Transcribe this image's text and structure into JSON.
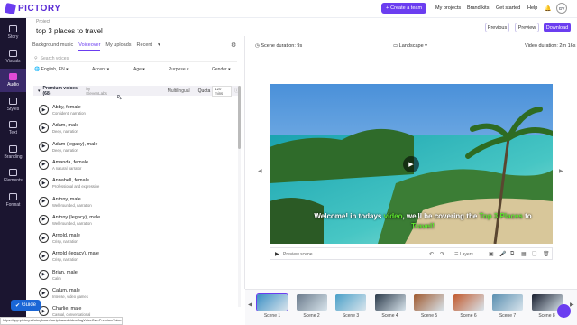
{
  "app": {
    "logo_text": "PICTORY"
  },
  "topbar": {
    "create_team": "Create a team",
    "my_projects": "My projects",
    "brand_kits": "Brand kits",
    "get_started": "Get started",
    "help": "Help",
    "avatar_initials": "GV"
  },
  "sidebar": {
    "items": [
      {
        "label": "Story",
        "icon": "story-icon"
      },
      {
        "label": "Visuals",
        "icon": "visuals-icon"
      },
      {
        "label": "Audio",
        "icon": "audio-icon",
        "active": true
      },
      {
        "label": "Styles",
        "icon": "styles-icon"
      },
      {
        "label": "Text",
        "icon": "text-icon"
      },
      {
        "label": "Branding",
        "icon": "branding-icon"
      },
      {
        "label": "Elements",
        "icon": "elements-icon"
      },
      {
        "label": "Format",
        "icon": "format-icon"
      }
    ]
  },
  "project": {
    "label": "Project",
    "title": "top 3 places to travel"
  },
  "header": {
    "previous": "Previous",
    "preview": "Preview",
    "download": "Download"
  },
  "audio_tabs": [
    "Background music",
    "Voiceover",
    "My uploads",
    "Recent"
  ],
  "search": {
    "placeholder": "Search voices"
  },
  "filters": {
    "language": "English, EN",
    "accent": "Accent",
    "age": "Age",
    "purpose": "Purpose",
    "gender": "Gender"
  },
  "premium": {
    "title": "Premium voices (68)",
    "provider": "by ElevenLabs",
    "multilingual": "Multilingual",
    "quota_label": "Quota",
    "quota_value": "120 mins"
  },
  "voices": [
    {
      "name": "Abby, female",
      "desc": "Confident, narration"
    },
    {
      "name": "Adam, male",
      "desc": "Deep, narration"
    },
    {
      "name": "Adam (legacy), male",
      "desc": "Deep, narration"
    },
    {
      "name": "Amanda, female",
      "desc": "A natural narrator"
    },
    {
      "name": "Annabell, female",
      "desc": "Professional and expressive"
    },
    {
      "name": "Antony, male",
      "desc": "Well-rounded, narration"
    },
    {
      "name": "Antony (legacy), male",
      "desc": "Well-rounded, narration"
    },
    {
      "name": "Arnold, male",
      "desc": "Crisp, narration"
    },
    {
      "name": "Arnold (legacy), male",
      "desc": "Crisp, narration"
    },
    {
      "name": "Brian, male",
      "desc": "Calm"
    },
    {
      "name": "Calum, male",
      "desc": "Intense, video games"
    },
    {
      "name": "Charlie, male",
      "desc": "Casual, conversational"
    }
  ],
  "scene_bar": {
    "scene_duration": "Scene duration: 9s",
    "orientation": "Landscape",
    "video_duration": "Video duration: 2m 16s"
  },
  "video": {
    "subtitle_pre": "Welcome! in todays ",
    "subtitle_hl1": "video",
    "subtitle_mid": ", we'll be covering the ",
    "subtitle_hl2": "Top 3 Places",
    "subtitle_post": " to ",
    "subtitle_hl3": "Travel!"
  },
  "controls": {
    "preview_scene": "Preview scene",
    "layers": "Layers"
  },
  "scenes": [
    "Scene 1",
    "Scene 2",
    "Scene 3",
    "Scene 4",
    "Scene 5",
    "Scene 6",
    "Scene 7",
    "Scene 8"
  ],
  "guide": {
    "label": "Guide"
  },
  "status_url": "https://app.pictory.ai/storyboard/scriptbasedvideo/flagVoiceOverPremiumVoices",
  "colors": {
    "accent": "#6b3df0",
    "sidebar": "#1b1530",
    "highlight": "#5ee62e",
    "guide": "#1a66d6"
  }
}
